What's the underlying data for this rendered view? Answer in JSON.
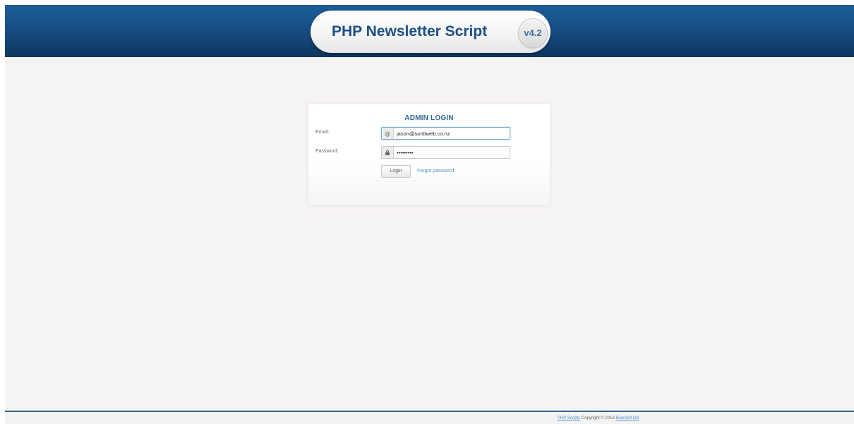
{
  "header": {
    "title": "PHP Newsletter Script",
    "version": "v4.2"
  },
  "login": {
    "title": "ADMIN LOGIN",
    "email_label": "Email:",
    "email_value": "jason@sortitweb.co.nz",
    "password_label": "Password:",
    "password_value": "•••••••••",
    "email_icon": "@",
    "login_button": "Login",
    "forgot_link": "Forgot password"
  },
  "footer": {
    "scripts_link": "PHP Scripts",
    "copyright": "Copyright © 2016",
    "company_link": "BlueSoft Ltd"
  },
  "icons": {
    "email": "at-sign-icon",
    "password": "lock-icon"
  },
  "colors": {
    "header_blue": "#174e85",
    "logo_text": "#1b4e86",
    "link_blue": "#4f93c5",
    "page_bg": "#f6f3f3"
  }
}
